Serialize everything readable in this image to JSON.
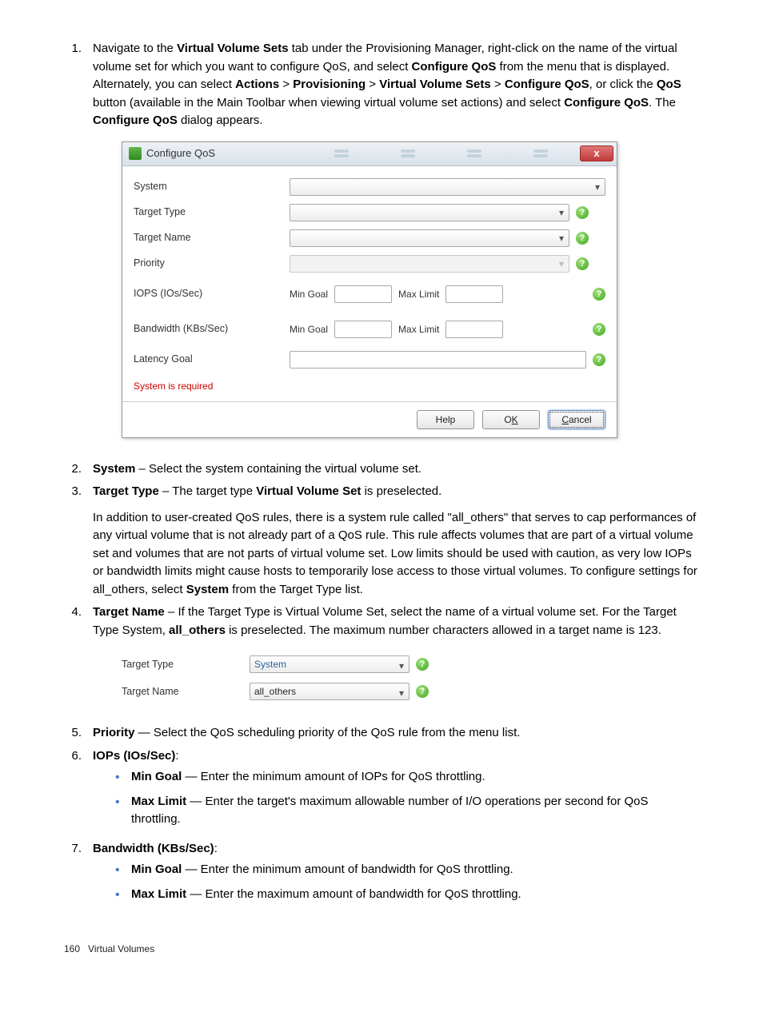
{
  "steps": {
    "s1": {
      "num": "1.",
      "text_a": "Navigate to the ",
      "b1": "Virtual Volume Sets",
      "text_b": " tab under the Provisioning Manager, right-click on the name of the virtual volume set for which you want to configure QoS, and select ",
      "b2": "Configure QoS",
      "text_c": " from the menu that is displayed. Alternately, you can select ",
      "b3": "Actions",
      "gt1": " > ",
      "b4": "Provisioning",
      "gt2": " > ",
      "b5": "Virtual Volume Sets",
      "gt3": " > ",
      "b6": "Configure QoS",
      "text_d": ", or click the ",
      "b7": "QoS",
      "text_e": " button (available in the Main Toolbar when viewing virtual volume set actions) and select ",
      "b8": "Configure QoS",
      "text_f": ". The ",
      "b9": "Configure QoS",
      "text_g": " dialog appears."
    },
    "s2": {
      "num": "2.",
      "b": "System",
      "t": " – Select the system containing the virtual volume set."
    },
    "s3": {
      "num": "3.",
      "b1": "Target Type",
      "t1": " – The target type ",
      "b2": "Virtual Volume Set",
      "t2": " is preselected.",
      "p2a": "In addition to user-created QoS rules, there is a system rule called \"all_others\" that serves to cap performances of any virtual volume that is not already part of a QoS rule. This rule affects volumes that are part of a virtual volume set and volumes that are not parts of virtual volume set. Low limits should be used with caution, as very low IOPs or bandwidth limits might cause hosts to temporarily lose access to those virtual volumes. To configure settings for all_others, select ",
      "p2b": "System",
      "p2c": " from the Target Type list."
    },
    "s4": {
      "num": "4.",
      "b1": "Target Name",
      "t1": " – If the Target Type is Virtual Volume Set, select the name of a virtual volume set. For the Target Type System, ",
      "b2": "all_others",
      "t2": " is preselected. The maximum number characters allowed in a target name is 123."
    },
    "s5": {
      "num": "5.",
      "b": "Priority",
      "t": " — Select the QoS scheduling priority of the QoS rule from the menu list."
    },
    "s6": {
      "num": "6.",
      "b": "IOPs (IOs/Sec)",
      "t": ":",
      "i1b": "Min Goal",
      "i1t": " — Enter the minimum amount of IOPs for QoS throttling.",
      "i2b": "Max Limit",
      "i2t": " — Enter the target's maximum allowable number of I/O operations per second for QoS throttling."
    },
    "s7": {
      "num": "7.",
      "b": "Bandwidth (KBs/Sec)",
      "t": ":",
      "i1b": "Min Goal",
      "i1t": " — Enter the minimum amount of bandwidth for QoS throttling.",
      "i2b": "Max Limit",
      "i2t": " — Enter the maximum amount of bandwidth for QoS throttling."
    }
  },
  "dialog1": {
    "title": "Configure QoS",
    "close": "x",
    "rows": {
      "system": "System",
      "target_type": "Target Type",
      "target_name": "Target Name",
      "priority": "Priority",
      "iops": "IOPS (IOs/Sec)",
      "bw": "Bandwidth (KBs/Sec)",
      "latency": "Latency Goal",
      "min_goal": "Min Goal",
      "max_limit": "Max Limit"
    },
    "error": "System is required",
    "buttons": {
      "help": "Help",
      "ok_pre": "O",
      "ok_mn": "K",
      "ok_post": "",
      "cancel_mn": "C",
      "cancel_post": "ancel"
    }
  },
  "dialog2": {
    "target_type_lbl": "Target Type",
    "target_type_val": "System",
    "target_name_lbl": "Target Name",
    "target_name_val": "all_others"
  },
  "footer": {
    "page": "160",
    "section": "Virtual Volumes"
  }
}
